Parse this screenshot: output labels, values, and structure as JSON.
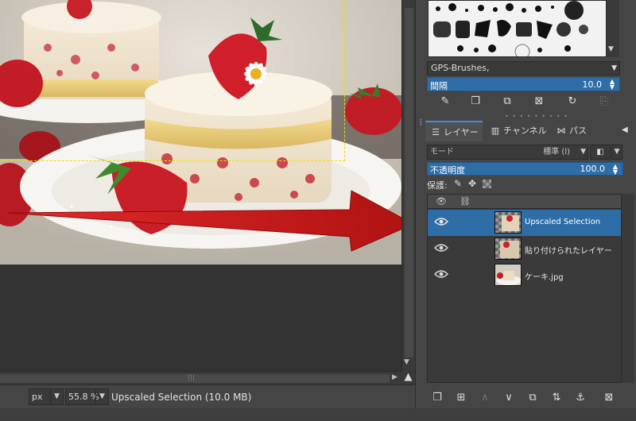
{
  "canvas": {
    "image_description": "cake-with-strawberries",
    "marquee_color": "#e8e000",
    "arrow_color": "#cc1a1a"
  },
  "statusbar": {
    "unit": "px",
    "zoom": "55.8 %",
    "status_text": "Upscaled Selection (10.0 MB)"
  },
  "brushes": {
    "selected_brush": "GPS-Brushes,",
    "spacing_label": "間隔",
    "spacing_value": "10.0",
    "actions": [
      "edit-brush-icon",
      "new-brush-icon",
      "duplicate-brush-icon",
      "delete-brush-icon",
      "refresh-icon",
      "open-as-image-icon"
    ]
  },
  "tabs": [
    {
      "label": "レイヤー",
      "icon": "layers-icon",
      "active": true
    },
    {
      "label": "チャンネル",
      "icon": "channels-icon",
      "active": false
    },
    {
      "label": "パス",
      "icon": "paths-icon",
      "active": false
    }
  ],
  "layer_options": {
    "mode_label": "モード",
    "mode_value": "標準 (l)",
    "opacity_label": "不透明度",
    "opacity_value": "100.0",
    "lock_label": "保護:"
  },
  "layers": [
    {
      "name": "Upscaled Selection",
      "visible": true,
      "selected": true
    },
    {
      "name": "貼り付けられたレイヤー",
      "visible": true,
      "selected": false
    },
    {
      "name": "ケーキ.jpg",
      "visible": true,
      "selected": false
    }
  ],
  "layer_actions": [
    "new-layer-icon",
    "new-layer-group-icon",
    "raise-layer-icon",
    "lower-layer-icon",
    "duplicate-layer-icon",
    "merge-layer-icon",
    "anchor-layer-icon",
    "delete-layer-icon"
  ],
  "colors": {
    "accent": "#2f6da6",
    "panel_bg": "#454545",
    "canvas_bg": "#333333"
  }
}
